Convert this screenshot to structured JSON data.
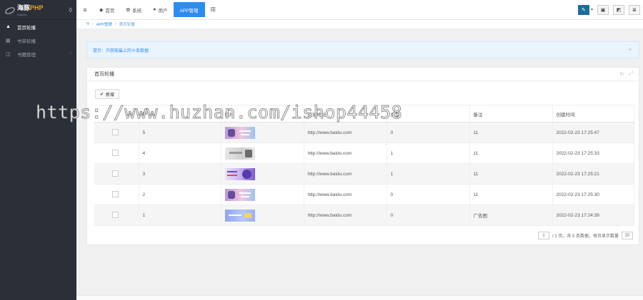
{
  "logo": {
    "brand_cn": "海豚",
    "brand_en": "PHP",
    "sub": "Dolphin"
  },
  "sidebar": {
    "items": [
      {
        "label": "首页轮播",
        "icon": "user-icon",
        "glyph": "▲"
      },
      {
        "label": "书单轮播",
        "icon": "grid-icon",
        "glyph": "▦"
      },
      {
        "label": "书籍管理",
        "icon": "box-icon",
        "glyph": "◫"
      }
    ]
  },
  "topbar": {
    "tabs": [
      {
        "label": "首页",
        "glyph": "◆"
      },
      {
        "label": "系统",
        "glyph": "✿"
      },
      {
        "label": "用户",
        "glyph": "●"
      },
      {
        "label": "APP管理",
        "glyph": ""
      }
    ],
    "grid_glyph": "⊞"
  },
  "breadcrumb": {
    "home_glyph": "⚲",
    "parent": "APP管理",
    "current": "首页轮播"
  },
  "alert": {
    "text": "提示：只获取最上的十条数据",
    "close": "×"
  },
  "panel": {
    "title": "首页轮播",
    "add_label": "新增",
    "add_glyph": "✔",
    "columns": [
      "",
      "ID",
      "图片",
      "链接地址",
      "类型",
      "备注",
      "创建时间"
    ],
    "rows": [
      {
        "id": "5",
        "link": "http://www.baidu.com",
        "type": "0",
        "note": "11",
        "time": "2022-02-23 17:25:47"
      },
      {
        "id": "4",
        "link": "http://www.baidu.com",
        "type": "1",
        "note": "11",
        "time": "2022-02-23 17:25:33"
      },
      {
        "id": "3",
        "link": "http://www.baidu.com",
        "type": "1",
        "note": "11",
        "time": "2022-02-23 17:25:21"
      },
      {
        "id": "2",
        "link": "http://www.baidu.com",
        "type": "0",
        "note": "11",
        "time": "2022-02-23 17:25:30"
      },
      {
        "id": "1",
        "link": "http://www.baidu.com",
        "type": "0",
        "note": "广告图",
        "time": "2022-02-23 17:24:39"
      }
    ]
  },
  "pager": {
    "page": "1",
    "summary": "/ 1 页，共 5 条数据，每页显示数量",
    "per_page": "20"
  },
  "watermark": "https://www.huzhan.com/ishop44458"
}
